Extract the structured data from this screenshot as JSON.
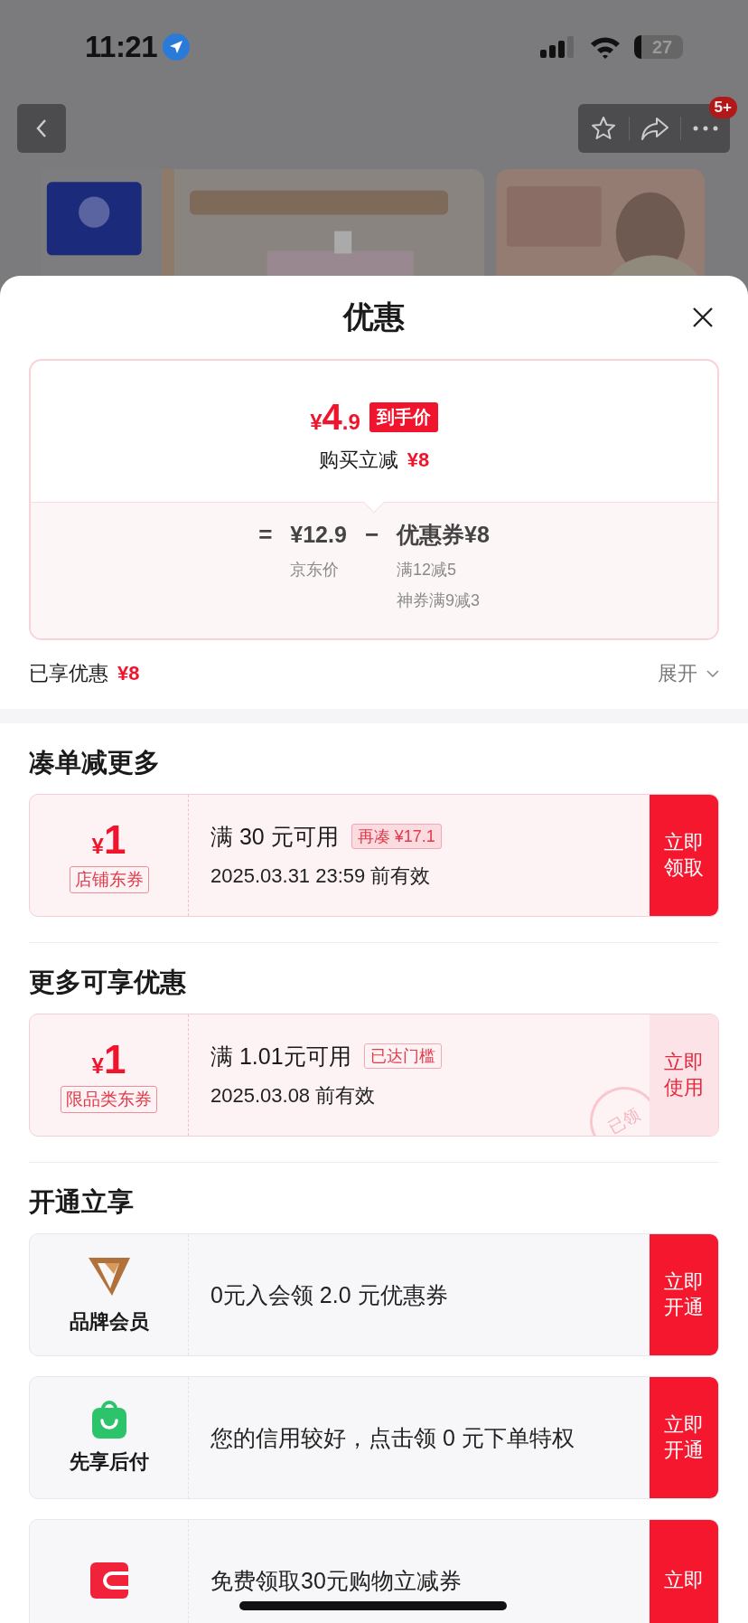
{
  "status_bar": {
    "time": "11:21",
    "battery": "27"
  },
  "nav": {
    "badge": "5+"
  },
  "sheet": {
    "title": "优惠"
  },
  "price_card": {
    "currency": "¥",
    "price_integer": "4",
    "price_decimal": ".9",
    "price_tag": "到手价",
    "reduction_label": "购买立减",
    "reduction_value": "¥8",
    "equals": "=",
    "jd_price": "¥12.9",
    "minus": "−",
    "coupon_total": "优惠券¥8",
    "jd_price_label": "京东价",
    "coupon_details": [
      "满12减5",
      "神券满9减3"
    ]
  },
  "summary": {
    "label": "已享优惠",
    "value": "¥8",
    "expand": "展开"
  },
  "coupon_sections": [
    {
      "title": "凑单减更多",
      "coupons": [
        {
          "currency": "¥",
          "amount": "1",
          "type": "店铺东券",
          "condition": "满 30 元可用",
          "tag": "再凑 ¥17.1",
          "validity": "2025.03.31 23:59 前有效",
          "button": "立即领取",
          "claimed": false
        }
      ]
    },
    {
      "title": "更多可享优惠",
      "coupons": [
        {
          "currency": "¥",
          "amount": "1",
          "type": "限品类东券",
          "condition": "满 1.01元可用",
          "tag": "已达门槛",
          "validity": "2025.03.08 前有效",
          "button": "立即使用",
          "claimed": true,
          "stamp": "已领"
        }
      ]
    }
  ],
  "membership_section": {
    "title": "开通立享",
    "items": [
      {
        "kind": "brand",
        "label": "品牌会员",
        "text": "0元入会领 2.0 元优惠券",
        "button": "立即开通"
      },
      {
        "kind": "paylater",
        "label": "先享后付",
        "text": "您的信用较好，点击领 0 元下单特权",
        "button": "立即开通"
      },
      {
        "kind": "wallet",
        "text": "免费领取30元购物立减券",
        "button": "立即"
      }
    ]
  }
}
